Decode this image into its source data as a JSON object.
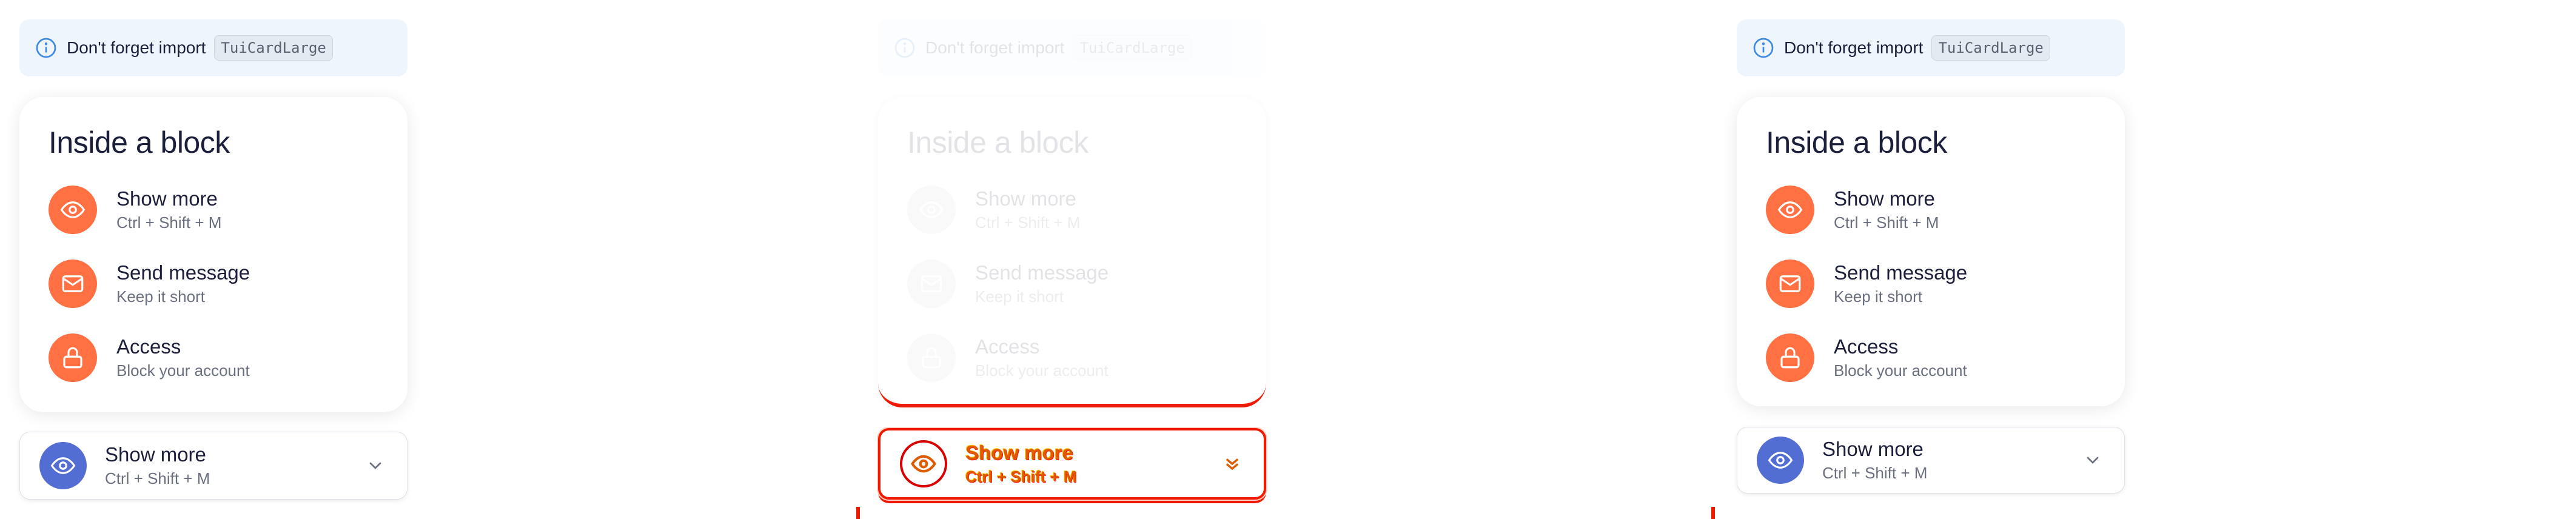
{
  "panels": [
    {
      "notice": {
        "text": "Don't forget import",
        "code": "TuiCardLarge"
      },
      "block": {
        "title": "Inside a block",
        "items": [
          {
            "title": "Show more",
            "subtitle": "Ctrl + Shift + M",
            "icon": "eye-icon"
          },
          {
            "title": "Send message",
            "subtitle": "Keep it short",
            "icon": "mail-icon"
          },
          {
            "title": "Access",
            "subtitle": "Block your account",
            "icon": "lock-icon"
          }
        ]
      },
      "select": {
        "title": "Show more",
        "subtitle": "Ctrl + Shift + M",
        "icon": "eye-icon"
      }
    },
    {
      "notice": {
        "text": "Don't forget import",
        "code": "TuiCardLarge"
      },
      "block": {
        "title": "Inside a block",
        "items": [
          {
            "title": "Show more",
            "subtitle": "Ctrl + Shift + M",
            "icon": "eye-icon"
          },
          {
            "title": "Send message",
            "subtitle": "Keep it short",
            "icon": "mail-icon"
          },
          {
            "title": "Access",
            "subtitle": "Block your account",
            "icon": "lock-icon"
          }
        ]
      },
      "select": {
        "title": "Show more",
        "subtitle": "Ctrl + Shift + M",
        "icon": "eye-icon"
      }
    },
    {
      "notice": {
        "text": "Don't forget import",
        "code": "TuiCardLarge"
      },
      "block": {
        "title": "Inside a block",
        "items": [
          {
            "title": "Show more",
            "subtitle": "Ctrl + Shift + M",
            "icon": "eye-icon"
          },
          {
            "title": "Send message",
            "subtitle": "Keep it short",
            "icon": "mail-icon"
          },
          {
            "title": "Access",
            "subtitle": "Block your account",
            "icon": "lock-icon"
          }
        ]
      },
      "select": {
        "title": "Show more",
        "subtitle": "Ctrl + Shift + M",
        "icon": "eye-icon"
      }
    }
  ],
  "colors": {
    "accent_orange": "#ff7043",
    "accent_blue": "#526ed3",
    "notice_bg": "#eef5fc",
    "diff_red": "#f01a00"
  }
}
